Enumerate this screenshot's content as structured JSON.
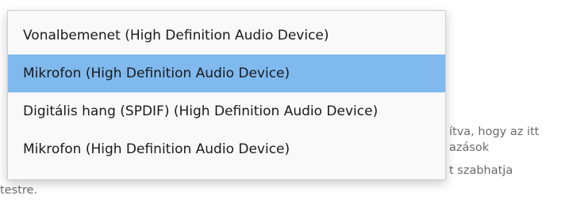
{
  "background_text": {
    "line1": "ítva, hogy az itt",
    "line2": "azások",
    "line3": "t szabhatja",
    "line4": "testre."
  },
  "dropdown": {
    "selected_index": 1,
    "options": [
      {
        "label": "Vonalbemenet (High Definition Audio Device)"
      },
      {
        "label": "Mikrofon (High Definition Audio Device)"
      },
      {
        "label": "Digitális hang (SPDIF) (High Definition Audio Device)"
      },
      {
        "label": "Mikrofon (High Definition Audio Device)"
      }
    ]
  }
}
